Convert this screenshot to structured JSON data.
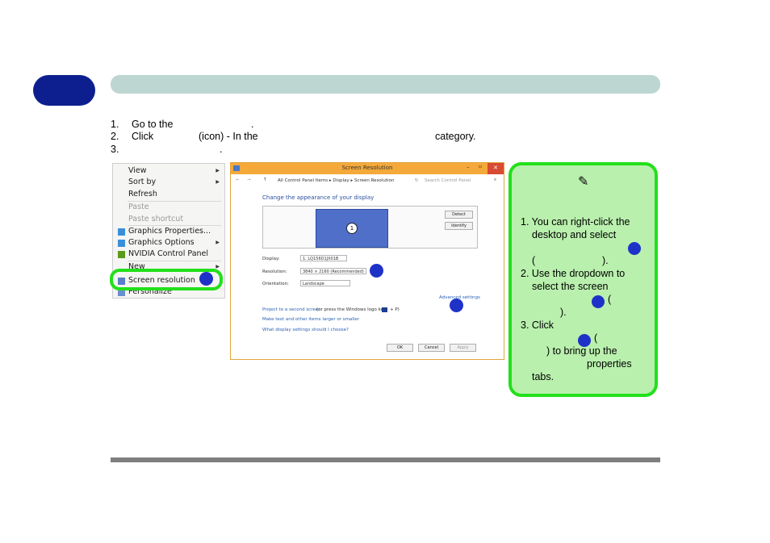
{
  "steps": [
    {
      "num": "1.",
      "text": "Go to the",
      "tail": "."
    },
    {
      "num": "2.",
      "text": "Click",
      "mid": "(icon) - In the",
      "tail": "category."
    },
    {
      "num": "3.",
      "text": "."
    }
  ],
  "context_menu": {
    "items": [
      {
        "label": "View",
        "submenu": true
      },
      {
        "label": "Sort by",
        "submenu": true
      },
      {
        "label": "Refresh"
      },
      {
        "label": "Paste",
        "disabled": true
      },
      {
        "label": "Paste shortcut",
        "disabled": true
      },
      {
        "label": "Graphics Properties..."
      },
      {
        "label": "Graphics Options",
        "submenu": true
      },
      {
        "label": "NVIDIA Control Panel"
      },
      {
        "label": "New",
        "submenu": true
      },
      {
        "label": "Screen resolution"
      },
      {
        "label": "Personalize"
      }
    ]
  },
  "window": {
    "title": "Screen Resolution",
    "breadcrumb": "All Control Panel Items  ▸  Display  ▸  Screen Resolution",
    "search_placeholder": "Search Control Panel",
    "heading": "Change the appearance of your display",
    "monitor_number": "1",
    "detect_label": "Detect",
    "identify_label": "Identify",
    "display_label": "Display:",
    "display_value": "1. LQ156D1JX01B",
    "resolution_label": "Resolution:",
    "resolution_value": "3840 × 2160 (Recommended)",
    "orientation_label": "Orientation:",
    "orientation_value": "Landscape",
    "advanced_link": "Advanced settings",
    "project_link": "Project to a second screen",
    "project_tail": "(or press the Windows logo key",
    "project_tail2": "+ P)",
    "text_size_link": "Make text and other items larger or smaller",
    "which_settings_link": "What display settings should I choose?",
    "ok_label": "OK",
    "cancel_label": "Cancel",
    "apply_label": "Apply"
  },
  "note": {
    "lines": [
      "1. You can right-click the",
      "desktop and select",
      "(",
      ").",
      "2. Use the dropdown to",
      "select the screen",
      "(",
      ").",
      "3. Click",
      "(",
      ") to bring up the",
      "properties",
      "tabs."
    ]
  },
  "colors": {
    "chapter_tab": "#0d1f8f",
    "header_bar": "#bdd6d2",
    "highlight_ring": "#22e01a",
    "note_bg": "#b9f0ad",
    "marker": "#1f32c8",
    "window_title": "#f4a93a",
    "link": "#2a61b4"
  }
}
